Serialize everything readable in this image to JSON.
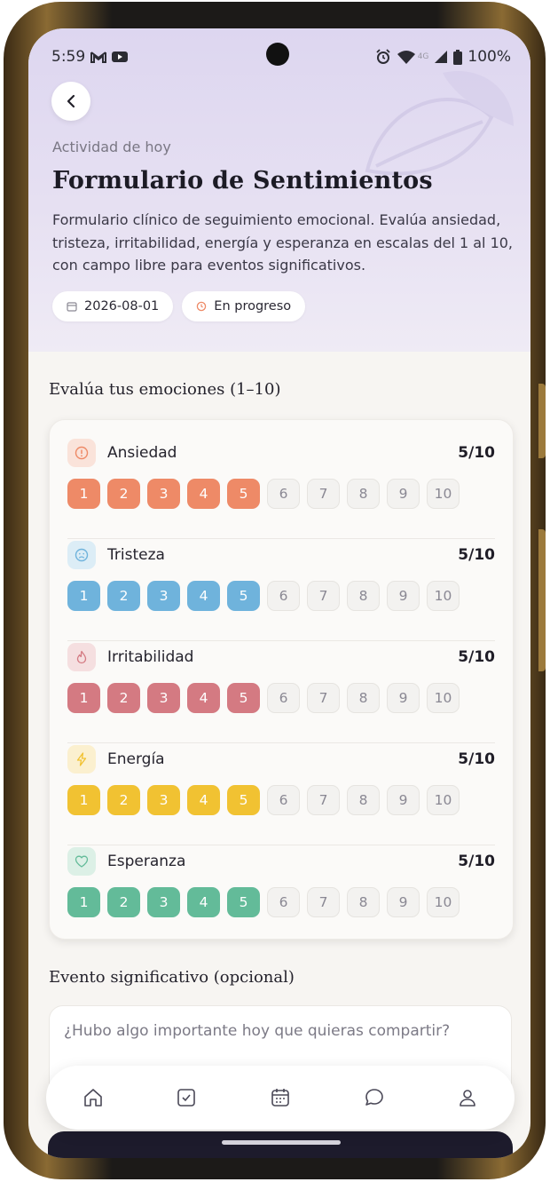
{
  "status": {
    "time": "5:59",
    "battery": "100%",
    "network": "4G"
  },
  "header": {
    "kicker": "Actividad de hoy",
    "title": "Formulario de Sentimientos",
    "description": "Formulario clínico de seguimiento emocional. Evalúa ansiedad, tristeza, irritabilidad, energía y esperanza en escalas del 1 al 10, con campo libre para eventos significativos.",
    "date_chip": "2026-08-01",
    "status_chip": "En progreso"
  },
  "section_emotions": "Evalúa tus emociones (1–10)",
  "emotions": [
    {
      "label": "Ansiedad",
      "score": "5/10",
      "level": 5,
      "color": "#ee8a67",
      "icon_bg": "#fae3da",
      "icon": "alert-icon"
    },
    {
      "label": "Tristeza",
      "score": "5/10",
      "level": 5,
      "color": "#6fb3dc",
      "icon_bg": "#dcedf6",
      "icon": "sad-face-icon"
    },
    {
      "label": "Irritabilidad",
      "score": "5/10",
      "level": 5,
      "color": "#d47a82",
      "icon_bg": "#f5dfe0",
      "icon": "flame-icon"
    },
    {
      "label": "Energía",
      "score": "5/10",
      "level": 5,
      "color": "#f1c232",
      "icon_bg": "#fbf0cf",
      "icon": "bolt-icon"
    },
    {
      "label": "Esperanza",
      "score": "5/10",
      "level": 5,
      "color": "#63bb99",
      "icon_bg": "#dcf0e6",
      "icon": "heart-icon"
    }
  ],
  "scale_numbers": [
    "1",
    "2",
    "3",
    "4",
    "5",
    "6",
    "7",
    "8",
    "9",
    "10"
  ],
  "section_event": "Evento significativo (opcional)",
  "event_placeholder": "¿Hubo algo importante hoy que quieras compartir?",
  "nav": [
    "home-icon",
    "checklist-icon",
    "calendar-icon",
    "chat-icon",
    "profile-icon"
  ]
}
